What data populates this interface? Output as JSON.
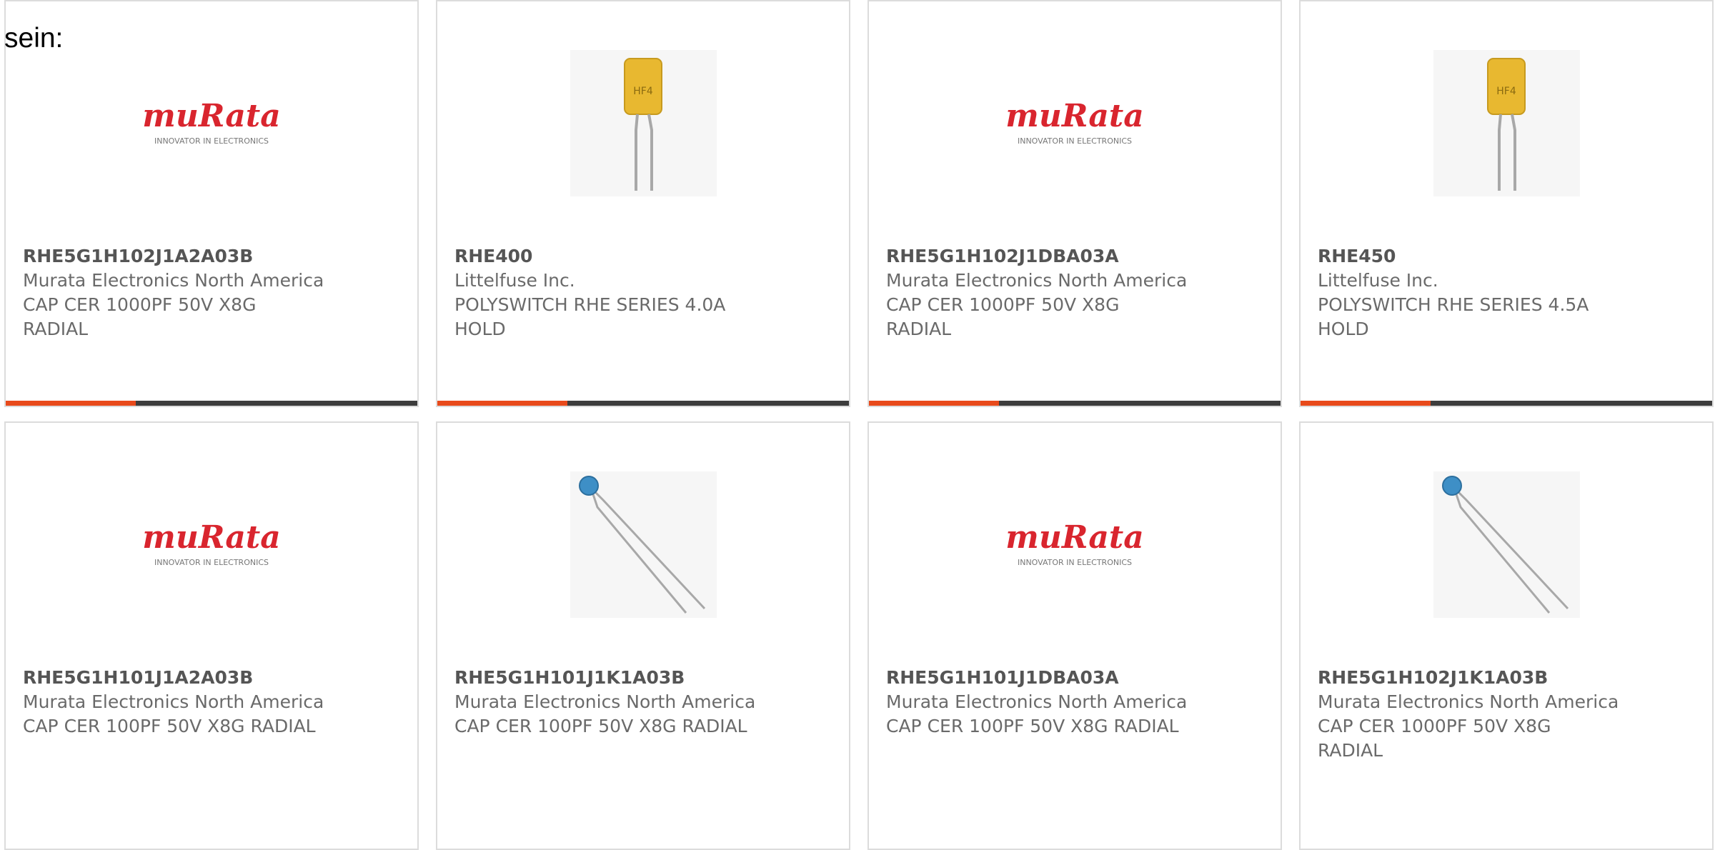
{
  "intro_text": "sein:",
  "brand_colors": {
    "accent": "#e84a1b",
    "bar": "#3d3d3d",
    "murata_red": "#d9252e"
  },
  "murata_logo": {
    "wordmark": "muRata",
    "tagline": "INNOVATOR IN ELECTRONICS"
  },
  "fuse_marking": "HF4",
  "products": [
    {
      "part_number": "RHE5G1H102J1A2A03B",
      "manufacturer": "Murata Electronics North America",
      "desc_line1": "CAP CER 1000PF 50V X8G",
      "desc_line2": "RADIAL",
      "image": "murata-logo"
    },
    {
      "part_number": "RHE400",
      "manufacturer": "Littelfuse Inc.",
      "desc_line1": "POLYSWITCH RHE SERIES 4.0A",
      "desc_line2": "HOLD",
      "image": "fuse-photo"
    },
    {
      "part_number": "RHE5G1H102J1DBA03A",
      "manufacturer": "Murata Electronics North America",
      "desc_line1": "CAP CER 1000PF 50V X8G",
      "desc_line2": "RADIAL",
      "image": "murata-logo"
    },
    {
      "part_number": "RHE450",
      "manufacturer": "Littelfuse Inc.",
      "desc_line1": "POLYSWITCH RHE SERIES 4.5A",
      "desc_line2": "HOLD",
      "image": "fuse-photo"
    },
    {
      "part_number": "RHE5G1H101J1A2A03B",
      "manufacturer": "Murata Electronics North America",
      "desc_line1": "CAP CER 100PF 50V X8G RADIAL",
      "desc_line2": "",
      "image": "murata-logo"
    },
    {
      "part_number": "RHE5G1H101J1K1A03B",
      "manufacturer": "Murata Electronics North America",
      "desc_line1": "CAP CER 100PF 50V X8G RADIAL",
      "desc_line2": "",
      "image": "capacitor-photo"
    },
    {
      "part_number": "RHE5G1H101J1DBA03A",
      "manufacturer": "Murata Electronics North America",
      "desc_line1": "CAP CER 100PF 50V X8G RADIAL",
      "desc_line2": "",
      "image": "murata-logo"
    },
    {
      "part_number": "RHE5G1H102J1K1A03B",
      "manufacturer": "Murata Electronics North America",
      "desc_line1": "CAP CER 1000PF 50V X8G",
      "desc_line2": "RADIAL",
      "image": "capacitor-photo"
    }
  ]
}
